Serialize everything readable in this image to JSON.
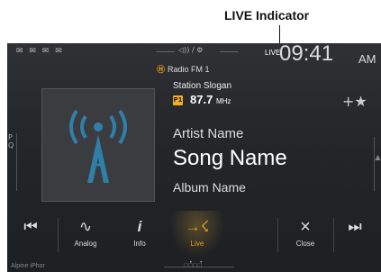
{
  "callout": {
    "label": "LIVE Indicator"
  },
  "status": {
    "left_icons": "✉ ✉ ✉ ✉",
    "center": "◁)) / ⚙"
  },
  "live_indicator": "LIVE",
  "clock": {
    "time": "09:41",
    "ampm": "AM"
  },
  "radio": {
    "source_icon": "Ⓗ",
    "source": "Radio FM 1",
    "slogan": "Station Slogan",
    "preset_badge": "P1",
    "frequency": "87.7",
    "frequency_unit": "MHz",
    "favorite": "+★"
  },
  "track": {
    "artist": "Artist Name",
    "song": "Song Name",
    "album": "Album Name"
  },
  "side_left": {
    "top": "P",
    "bottom": "Q"
  },
  "side_right": "▲",
  "controls": {
    "prev_icon": "⏮",
    "analog_icon": "∿",
    "analog_label": "Analog",
    "info_icon": "i",
    "info_label": "Info",
    "live_icon": "→☇",
    "live_label": "Live",
    "close_icon": "×",
    "close_label": "Close",
    "next_icon": "⏭"
  },
  "page_dots": "• •",
  "footer": {
    "left": "Alpine iPhor",
    "center": "□□□□"
  },
  "colors": {
    "accent": "#f0a020",
    "background": "#24262a"
  }
}
